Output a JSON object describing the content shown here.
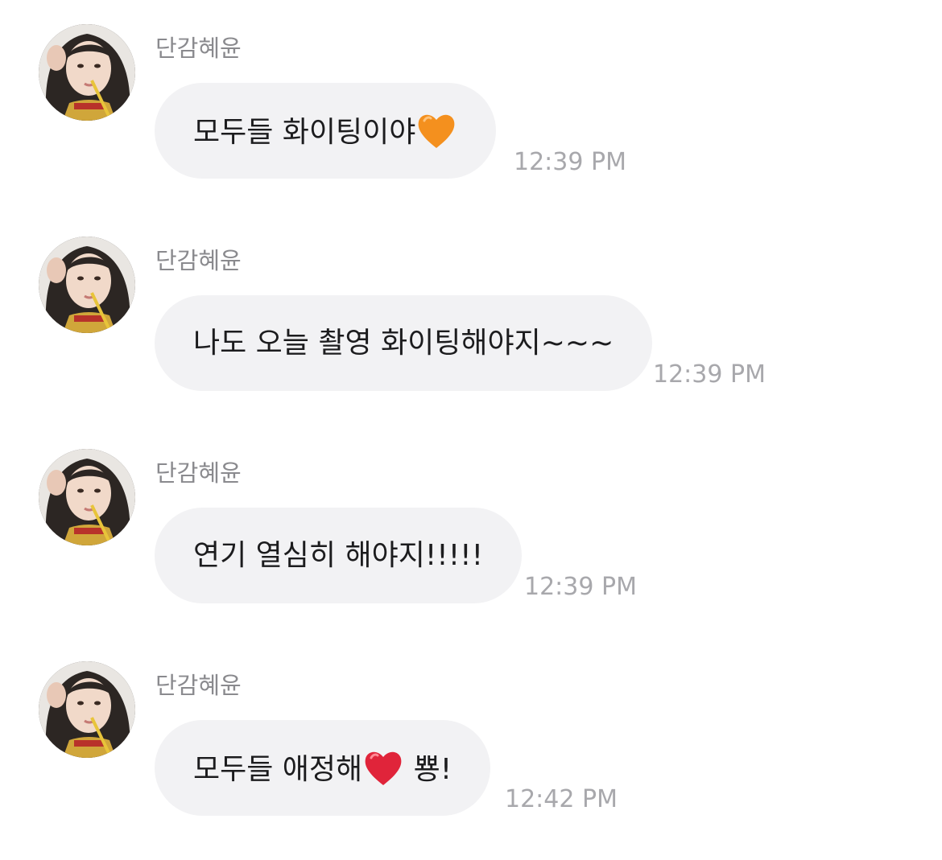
{
  "messages": [
    {
      "sender": "단감혜윤",
      "text_before": "모두들 화이팅이야",
      "emoji": "orange-heart-icon",
      "emoji_color": "#f4901e",
      "text_after": "",
      "time": "12:39 PM"
    },
    {
      "sender": "단감혜윤",
      "text_before": "나도 오늘 촬영 화이팅해야지~~~",
      "emoji": "",
      "text_after": "",
      "time": "12:39 PM"
    },
    {
      "sender": "단감혜윤",
      "text_before": "연기 열심히 해야지!!!!!",
      "emoji": "",
      "text_after": "",
      "time": "12:39 PM"
    },
    {
      "sender": "단감혜윤",
      "text_before": "모두들 애정해",
      "emoji": "red-heart-icon",
      "emoji_color": "#e0243a",
      "text_after": " 뿅!",
      "time": "12:42 PM"
    }
  ],
  "colors": {
    "bubble_bg": "#f2f2f4",
    "message_text": "#1c1c1e",
    "sender_text": "#8a8a8e",
    "time_text": "#a8a8ac"
  }
}
